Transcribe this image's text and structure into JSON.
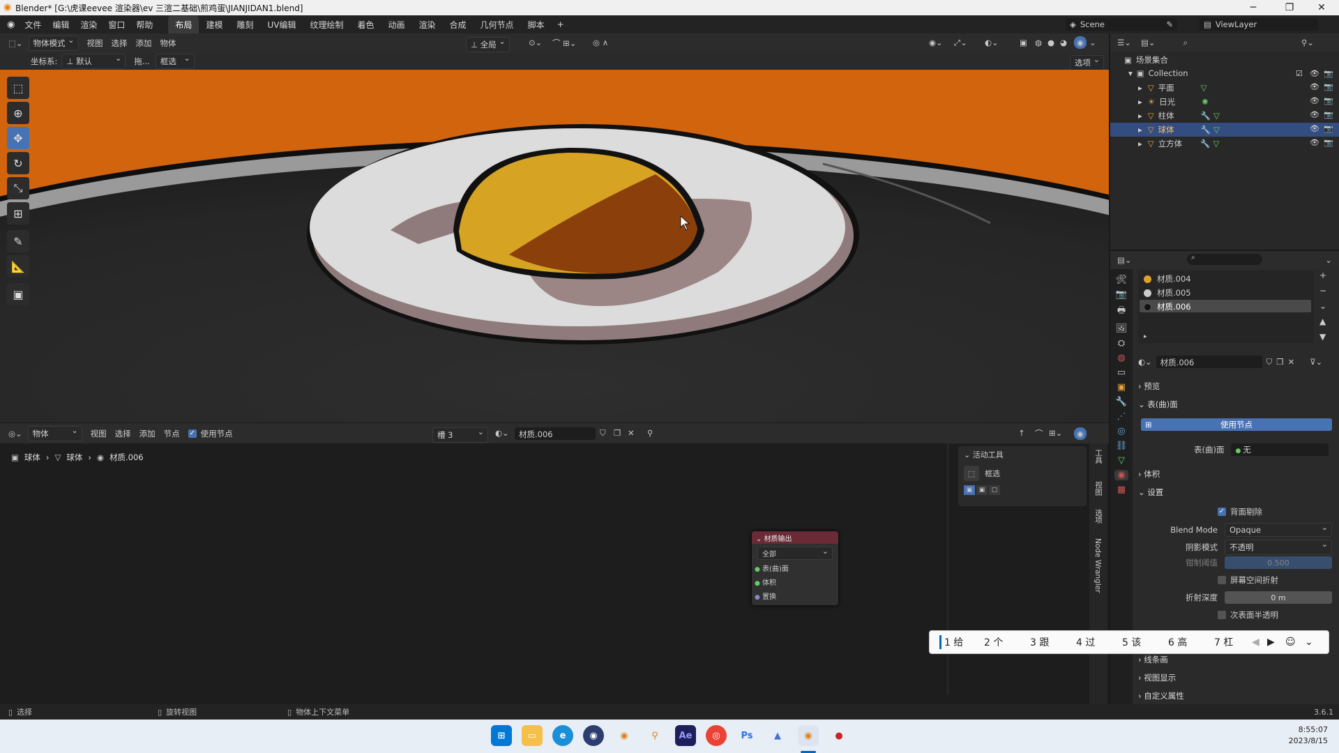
{
  "window": {
    "title": "Blender* [G:\\虎课eevee 渲染器\\ev 三渲二基础\\煎鸡蛋\\JIANJIDAN1.blend]",
    "minimize": "─",
    "maximize": "❐",
    "close": "✕"
  },
  "menu": {
    "items": [
      "文件",
      "编辑",
      "渲染",
      "窗口",
      "帮助"
    ],
    "workspaces": [
      "布局",
      "建模",
      "雕刻",
      "UV编辑",
      "纹理绘制",
      "着色",
      "动画",
      "渲染",
      "合成",
      "几何节点",
      "脚本"
    ],
    "active_workspace": "布局",
    "add_tab": "+",
    "scene": "Scene",
    "view_layer": "ViewLayer"
  },
  "viewport": {
    "mode": "物体模式",
    "menu": [
      "视图",
      "选择",
      "添加",
      "物体"
    ],
    "transform_orientation": "全局",
    "coord_label": "坐标系:",
    "coord_value": "默认",
    "drag_label": "拖...",
    "select_mode": "框选",
    "options": "选项"
  },
  "outliner": {
    "root": "场景集合",
    "collection": "Collection",
    "objects": [
      {
        "name": "平面",
        "selected": false
      },
      {
        "name": "日光",
        "selected": false
      },
      {
        "name": "柱体",
        "selected": false
      },
      {
        "name": "球体",
        "selected": true
      },
      {
        "name": "立方体",
        "selected": false
      }
    ]
  },
  "node_editor": {
    "editor_type": "物体",
    "menu": [
      "视图",
      "选择",
      "添加",
      "节点"
    ],
    "use_nodes_label": "使用节点",
    "slot": "槽 3",
    "material": "材质.006",
    "breadcrumb": [
      "球体",
      "球体",
      "材质.006"
    ],
    "node": {
      "title": "材质输出",
      "target": "全部",
      "sockets": [
        "表(曲)面",
        "体积",
        "置换"
      ]
    },
    "active_tool_header": "活动工具",
    "active_tool": "框选",
    "side_tabs": [
      "工具",
      "视图",
      "选项",
      "Node Wrangler"
    ]
  },
  "properties": {
    "materials": [
      {
        "name": "材质.004",
        "color": "#e0a030"
      },
      {
        "name": "材质.005",
        "color": "#cccccc"
      },
      {
        "name": "材质.006",
        "color": "#111111"
      }
    ],
    "active_material": "材质.006",
    "sections": {
      "preview": "预览",
      "surface": "表(曲)面",
      "volume": "体积",
      "settings": "设置",
      "line_art": "线条画",
      "viewport_display": "视图显示",
      "custom_props": "自定义属性"
    },
    "use_nodes_button": "使用节点",
    "surface_label": "表(曲)面",
    "surface_value": "无",
    "backface_culling": "背面剔除",
    "blend_mode_label": "Blend Mode",
    "blend_mode_value": "Opaque",
    "shadow_mode_label": "阴影模式",
    "shadow_mode_value": "不透明",
    "clip_label": "钳制阈值",
    "clip_value": "0.500",
    "screen_refraction": "屏幕空间折射",
    "refraction_depth_label": "折射深度",
    "refraction_depth_value": "0 m",
    "subsurface_translucency": "次表面半透明"
  },
  "ime": {
    "candidates": [
      "1 给",
      "2 个",
      "3 跟",
      "4 过",
      "5 该",
      "6 高",
      "7 杠"
    ]
  },
  "statusbar": {
    "select": "选择",
    "rotate": "旋转视图",
    "context": "物体上下文菜单",
    "version": "3.6.1"
  },
  "taskbar": {
    "time": "8:55:07",
    "date": "2023/8/15"
  },
  "colors": {
    "accent": "#4772b3",
    "background_orange": "#d0640c",
    "yolk_yellow": "#d4a020",
    "yolk_brown": "#8a3f0a",
    "egg_white": "#dcdcdc"
  }
}
